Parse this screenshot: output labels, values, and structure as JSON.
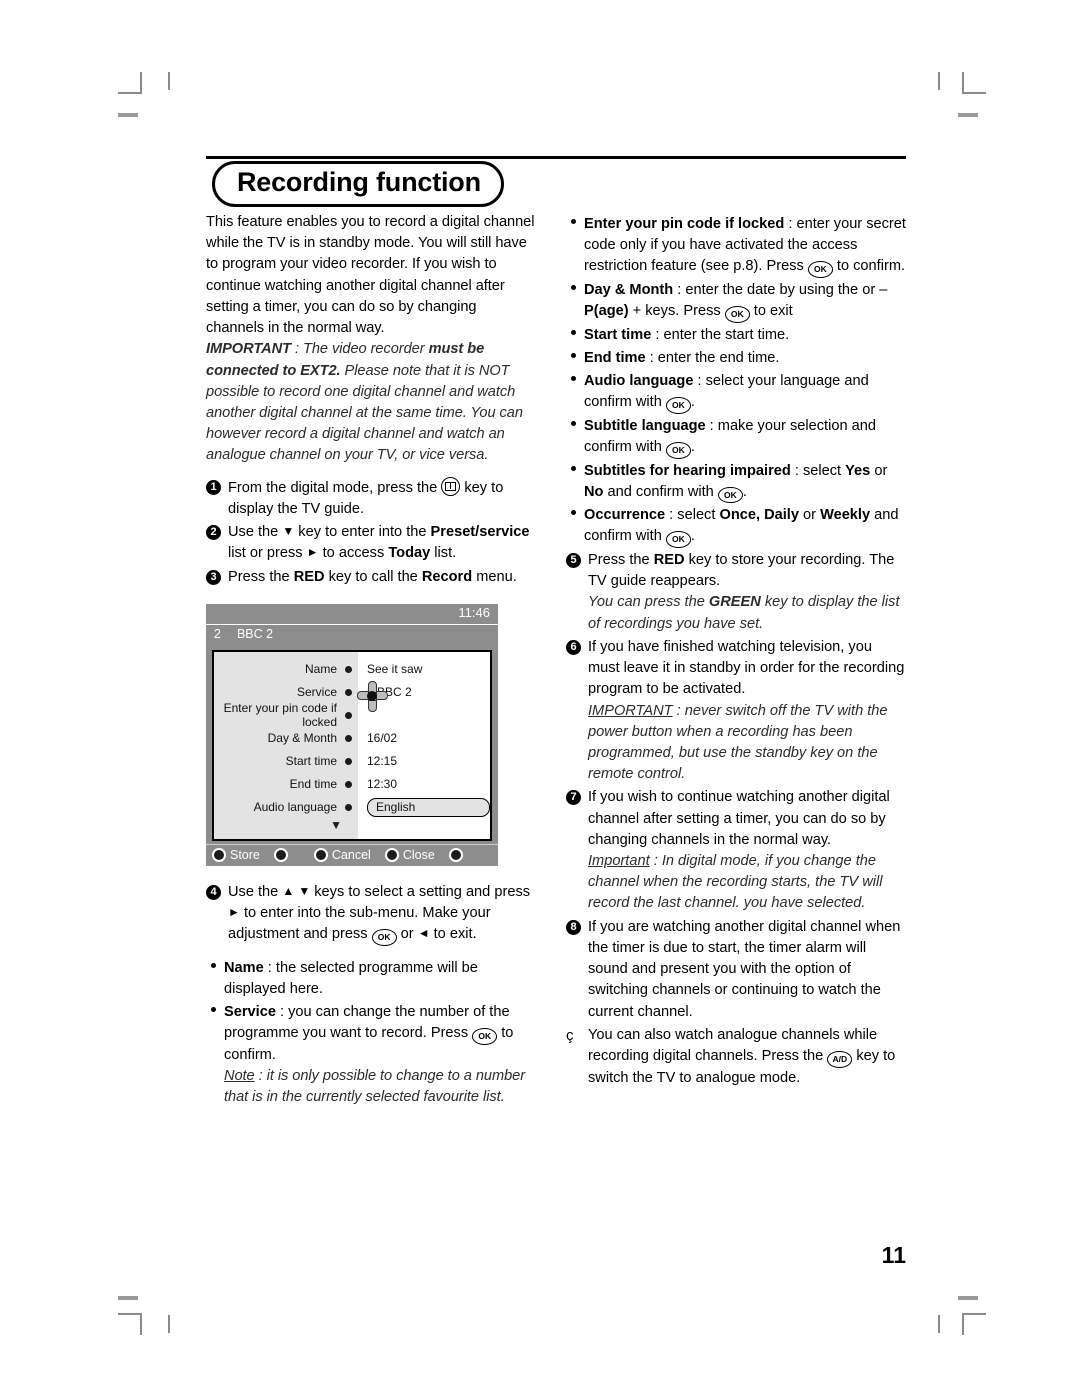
{
  "page": {
    "title": "Recording function",
    "number": "11"
  },
  "left_column": {
    "intro": "This feature enables you to record a digital channel while the TV is in standby mode. You will still have to program your video recorder. If you wish to continue watching another digital channel after setting a timer, you can do so by changing channels in the normal way.",
    "important_label": "IMPORTANT",
    "important_sep": " : ",
    "important_text_1": "The video recorder ",
    "important_bold_1": "must be connected to EXT2.",
    "important_text_2": " Please note that it is NOT possible to record one digital channel and watch another digital channel at the same time. You can however record a digital channel and watch an analogue channel on your TV, or vice versa.",
    "steps": [
      {
        "num": "1",
        "parts": [
          {
            "t": "From the digital mode, press the "
          },
          {
            "icon": "tv-guide-key-icon"
          },
          {
            "t": " key to display the TV guide."
          }
        ]
      },
      {
        "num": "2",
        "parts": [
          {
            "t": "Use the "
          },
          {
            "glyph": "▼"
          },
          {
            "t": " key to enter into the "
          },
          {
            "b": "Preset/service"
          },
          {
            "t": " list or press "
          },
          {
            "glyph": "►"
          },
          {
            "t": " to access "
          },
          {
            "b": "Today"
          },
          {
            "t": " list."
          }
        ]
      },
      {
        "num": "3",
        "parts": [
          {
            "t": "Press the "
          },
          {
            "b": "RED"
          },
          {
            "t": " key to call the "
          },
          {
            "b": "Record"
          },
          {
            "t": " menu."
          }
        ]
      },
      {
        "num": "4",
        "parts": [
          {
            "t": "Use the "
          },
          {
            "glyph": "▲"
          },
          {
            "t": " "
          },
          {
            "glyph": "▼"
          },
          {
            "t": " keys to select a setting and press "
          },
          {
            "glyph": "►"
          },
          {
            "t": " to enter into the sub-menu. Make your adjustment and press "
          },
          {
            "key": "OK"
          },
          {
            "t": " or "
          },
          {
            "glyph": "◄"
          },
          {
            "t": "  to exit."
          }
        ]
      }
    ],
    "bullets": [
      {
        "parts": [
          {
            "b": "Name"
          },
          {
            "t": " :  the selected programme will be displayed here."
          }
        ]
      },
      {
        "parts": [
          {
            "b": "Service"
          },
          {
            "t": " :  you can change the number of the programme you want to record. Press "
          },
          {
            "key": "OK"
          },
          {
            "t": " to confirm."
          }
        ]
      }
    ],
    "note_label": "Note",
    "note_text": " : it is only possible to change to a number that is in the currently selected favourite list."
  },
  "tv_screen": {
    "clock": "11:46",
    "channel_number": "2",
    "channel_name": "BBC 2",
    "cursor_icon": "dpad-cursor-icon",
    "rows": [
      {
        "label": "Name",
        "value": "See it saw",
        "type": "text"
      },
      {
        "label": "Service",
        "value": "2 BBC 2",
        "type": "text"
      },
      {
        "label": "Enter your pin code if locked",
        "value": "",
        "type": "text"
      },
      {
        "label": "Day & Month",
        "value": "16/02",
        "type": "text"
      },
      {
        "label": "Start time",
        "value": "12:15",
        "type": "text"
      },
      {
        "label": "End time",
        "value": "12:30",
        "type": "text"
      },
      {
        "label": "Audio language",
        "value": "English",
        "type": "select"
      }
    ],
    "scroll_indicator": "▼",
    "buttons": [
      {
        "label": "Store"
      },
      {
        "label": ""
      },
      {
        "label": "Cancel"
      },
      {
        "label": "Close"
      },
      {
        "label": ""
      }
    ]
  },
  "right_column": {
    "bullets": [
      {
        "parts": [
          {
            "b": "Enter your pin code if locked"
          },
          {
            "t": " : enter your secret code only if you have activated the access restriction feature (see p.8). Press "
          },
          {
            "key": "OK"
          },
          {
            "t": " to confirm."
          }
        ]
      },
      {
        "parts": [
          {
            "b": "Day & Month"
          },
          {
            "t": " : enter the date by using the  or – "
          },
          {
            "b": "P(age)"
          },
          {
            "t": " + keys. Press "
          },
          {
            "key": "OK"
          },
          {
            "t": " to exit"
          }
        ]
      },
      {
        "parts": [
          {
            "b": "Start time"
          },
          {
            "t": " : enter the start time."
          }
        ]
      },
      {
        "parts": [
          {
            "b": "End time"
          },
          {
            "t": " : enter the end time."
          }
        ]
      },
      {
        "parts": [
          {
            "b": "Audio language"
          },
          {
            "t": " : select your language and confirm with "
          },
          {
            "key": "OK"
          },
          {
            "t": "."
          }
        ]
      },
      {
        "parts": [
          {
            "b": "Subtitle language"
          },
          {
            "t": " : make your selection and confirm with "
          },
          {
            "key": "OK"
          },
          {
            "t": "."
          }
        ]
      },
      {
        "parts": [
          {
            "b": "Subtitles for hearing impaired"
          },
          {
            "t": " : select "
          },
          {
            "b": "Yes"
          },
          {
            "t": " or "
          },
          {
            "b": "No"
          },
          {
            "t": " and confirm with "
          },
          {
            "key": "OK"
          },
          {
            "t": "."
          }
        ]
      },
      {
        "parts": [
          {
            "b": "Occurrence"
          },
          {
            "t": " : select "
          },
          {
            "b": "Once, Daily"
          },
          {
            "t": " or "
          },
          {
            "b": "Weekly"
          },
          {
            "t": " and confirm with "
          },
          {
            "key": "OK"
          },
          {
            "t": "."
          }
        ]
      }
    ],
    "steps": [
      {
        "num": "5",
        "parts": [
          {
            "t": "Press the "
          },
          {
            "b": "RED"
          },
          {
            "t": " key to store your recording. The TV guide reappears."
          }
        ],
        "note": [
          {
            "i": "You can press the "
          },
          {
            "ib": "GREEN"
          },
          {
            "i": " key to display the list of recordings you have set."
          }
        ]
      },
      {
        "num": "6",
        "parts": [
          {
            "t": "If you have finished watching television, you must leave it in standby in order for the recording program to be activated."
          }
        ],
        "note": [
          {
            "iu": "IMPORTANT"
          },
          {
            "i": " : never switch off the TV with the power button when a recording has been programmed, but use the standby key on the remote control."
          }
        ]
      },
      {
        "num": "7",
        "parts": [
          {
            "t": "If you wish to continue watching another digital channel after setting a timer, you can do so by changing channels in the normal way."
          }
        ],
        "note": [
          {
            "iu": "Important"
          },
          {
            "i": " : In digital mode, if you change the channel when the recording starts, the TV will record the last channel. you have selected."
          }
        ]
      },
      {
        "num": "8",
        "parts": [
          {
            "t": "If you are watching another digital channel when the timer is due to start, the timer alarm will sound and present you with the option of switching channels or continuing to watch the current channel."
          }
        ]
      },
      {
        "num": "ç",
        "plain_marker": true,
        "parts": [
          {
            "t": "You can also watch analogue channels while recording digital channels. Press the "
          },
          {
            "key": "A/D"
          },
          {
            "t": " key to switch the TV to analogue mode."
          }
        ]
      }
    ]
  }
}
